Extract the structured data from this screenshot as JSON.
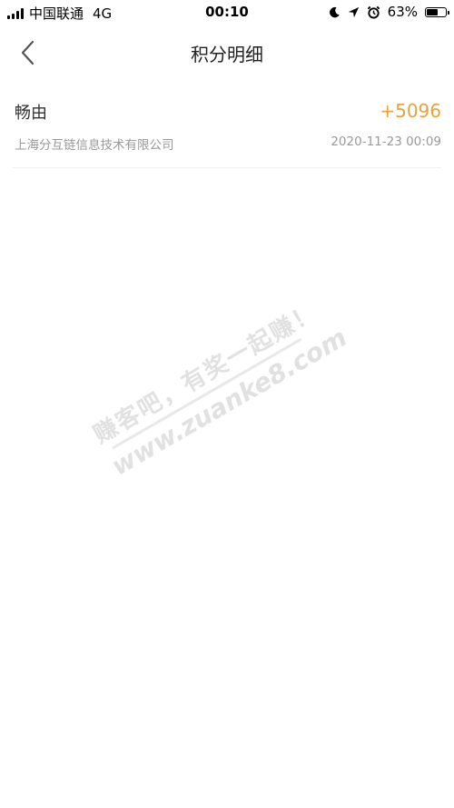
{
  "status_bar": {
    "carrier": "中国联通",
    "network": "4G",
    "time": "00:10",
    "battery_percent": "63%",
    "battery_level": 0.63,
    "icons": [
      "signal-icon",
      "moon-icon",
      "location-arrow-icon",
      "alarm-icon",
      "battery-icon"
    ]
  },
  "nav": {
    "title": "积分明细",
    "back_icon": "chevron-left-icon"
  },
  "records": [
    {
      "name": "畅由",
      "points": "+5096",
      "company": "上海分互链信息技术有限公司",
      "time": "2020-11-23 00:09"
    }
  ],
  "watermark": {
    "line1": "赚客吧，有奖一起赚！",
    "line2": "www.zuanke8.com"
  },
  "colors": {
    "points": "#e8a33c",
    "secondary_text": "#999999",
    "primary_text": "#333333"
  }
}
